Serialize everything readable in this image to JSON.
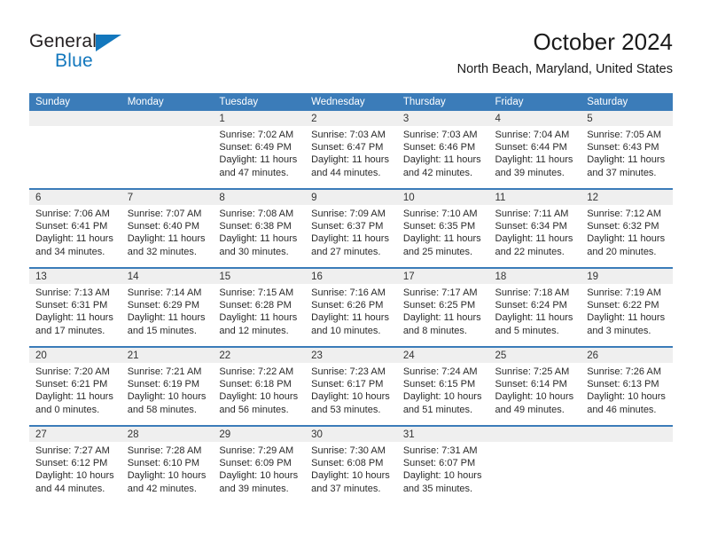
{
  "brand": {
    "name_part1": "General",
    "name_part2": "Blue",
    "triangle_color": "#1277bd"
  },
  "header": {
    "title": "October 2024",
    "subtitle": "North Beach, Maryland, United States",
    "accent_color": "#3b7cb9",
    "daynum_band_color": "#efefef"
  },
  "calendar": {
    "weekday_headers": [
      "Sunday",
      "Monday",
      "Tuesday",
      "Wednesday",
      "Thursday",
      "Friday",
      "Saturday"
    ],
    "weeks": [
      [
        {
          "day": "",
          "sunrise": "",
          "sunset": "",
          "daylight_line1": "",
          "daylight_line2": ""
        },
        {
          "day": "",
          "sunrise": "",
          "sunset": "",
          "daylight_line1": "",
          "daylight_line2": ""
        },
        {
          "day": "1",
          "sunrise": "Sunrise: 7:02 AM",
          "sunset": "Sunset: 6:49 PM",
          "daylight_line1": "Daylight: 11 hours",
          "daylight_line2": "and 47 minutes."
        },
        {
          "day": "2",
          "sunrise": "Sunrise: 7:03 AM",
          "sunset": "Sunset: 6:47 PM",
          "daylight_line1": "Daylight: 11 hours",
          "daylight_line2": "and 44 minutes."
        },
        {
          "day": "3",
          "sunrise": "Sunrise: 7:03 AM",
          "sunset": "Sunset: 6:46 PM",
          "daylight_line1": "Daylight: 11 hours",
          "daylight_line2": "and 42 minutes."
        },
        {
          "day": "4",
          "sunrise": "Sunrise: 7:04 AM",
          "sunset": "Sunset: 6:44 PM",
          "daylight_line1": "Daylight: 11 hours",
          "daylight_line2": "and 39 minutes."
        },
        {
          "day": "5",
          "sunrise": "Sunrise: 7:05 AM",
          "sunset": "Sunset: 6:43 PM",
          "daylight_line1": "Daylight: 11 hours",
          "daylight_line2": "and 37 minutes."
        }
      ],
      [
        {
          "day": "6",
          "sunrise": "Sunrise: 7:06 AM",
          "sunset": "Sunset: 6:41 PM",
          "daylight_line1": "Daylight: 11 hours",
          "daylight_line2": "and 34 minutes."
        },
        {
          "day": "7",
          "sunrise": "Sunrise: 7:07 AM",
          "sunset": "Sunset: 6:40 PM",
          "daylight_line1": "Daylight: 11 hours",
          "daylight_line2": "and 32 minutes."
        },
        {
          "day": "8",
          "sunrise": "Sunrise: 7:08 AM",
          "sunset": "Sunset: 6:38 PM",
          "daylight_line1": "Daylight: 11 hours",
          "daylight_line2": "and 30 minutes."
        },
        {
          "day": "9",
          "sunrise": "Sunrise: 7:09 AM",
          "sunset": "Sunset: 6:37 PM",
          "daylight_line1": "Daylight: 11 hours",
          "daylight_line2": "and 27 minutes."
        },
        {
          "day": "10",
          "sunrise": "Sunrise: 7:10 AM",
          "sunset": "Sunset: 6:35 PM",
          "daylight_line1": "Daylight: 11 hours",
          "daylight_line2": "and 25 minutes."
        },
        {
          "day": "11",
          "sunrise": "Sunrise: 7:11 AM",
          "sunset": "Sunset: 6:34 PM",
          "daylight_line1": "Daylight: 11 hours",
          "daylight_line2": "and 22 minutes."
        },
        {
          "day": "12",
          "sunrise": "Sunrise: 7:12 AM",
          "sunset": "Sunset: 6:32 PM",
          "daylight_line1": "Daylight: 11 hours",
          "daylight_line2": "and 20 minutes."
        }
      ],
      [
        {
          "day": "13",
          "sunrise": "Sunrise: 7:13 AM",
          "sunset": "Sunset: 6:31 PM",
          "daylight_line1": "Daylight: 11 hours",
          "daylight_line2": "and 17 minutes."
        },
        {
          "day": "14",
          "sunrise": "Sunrise: 7:14 AM",
          "sunset": "Sunset: 6:29 PM",
          "daylight_line1": "Daylight: 11 hours",
          "daylight_line2": "and 15 minutes."
        },
        {
          "day": "15",
          "sunrise": "Sunrise: 7:15 AM",
          "sunset": "Sunset: 6:28 PM",
          "daylight_line1": "Daylight: 11 hours",
          "daylight_line2": "and 12 minutes."
        },
        {
          "day": "16",
          "sunrise": "Sunrise: 7:16 AM",
          "sunset": "Sunset: 6:26 PM",
          "daylight_line1": "Daylight: 11 hours",
          "daylight_line2": "and 10 minutes."
        },
        {
          "day": "17",
          "sunrise": "Sunrise: 7:17 AM",
          "sunset": "Sunset: 6:25 PM",
          "daylight_line1": "Daylight: 11 hours",
          "daylight_line2": "and 8 minutes."
        },
        {
          "day": "18",
          "sunrise": "Sunrise: 7:18 AM",
          "sunset": "Sunset: 6:24 PM",
          "daylight_line1": "Daylight: 11 hours",
          "daylight_line2": "and 5 minutes."
        },
        {
          "day": "19",
          "sunrise": "Sunrise: 7:19 AM",
          "sunset": "Sunset: 6:22 PM",
          "daylight_line1": "Daylight: 11 hours",
          "daylight_line2": "and 3 minutes."
        }
      ],
      [
        {
          "day": "20",
          "sunrise": "Sunrise: 7:20 AM",
          "sunset": "Sunset: 6:21 PM",
          "daylight_line1": "Daylight: 11 hours",
          "daylight_line2": "and 0 minutes."
        },
        {
          "day": "21",
          "sunrise": "Sunrise: 7:21 AM",
          "sunset": "Sunset: 6:19 PM",
          "daylight_line1": "Daylight: 10 hours",
          "daylight_line2": "and 58 minutes."
        },
        {
          "day": "22",
          "sunrise": "Sunrise: 7:22 AM",
          "sunset": "Sunset: 6:18 PM",
          "daylight_line1": "Daylight: 10 hours",
          "daylight_line2": "and 56 minutes."
        },
        {
          "day": "23",
          "sunrise": "Sunrise: 7:23 AM",
          "sunset": "Sunset: 6:17 PM",
          "daylight_line1": "Daylight: 10 hours",
          "daylight_line2": "and 53 minutes."
        },
        {
          "day": "24",
          "sunrise": "Sunrise: 7:24 AM",
          "sunset": "Sunset: 6:15 PM",
          "daylight_line1": "Daylight: 10 hours",
          "daylight_line2": "and 51 minutes."
        },
        {
          "day": "25",
          "sunrise": "Sunrise: 7:25 AM",
          "sunset": "Sunset: 6:14 PM",
          "daylight_line1": "Daylight: 10 hours",
          "daylight_line2": "and 49 minutes."
        },
        {
          "day": "26",
          "sunrise": "Sunrise: 7:26 AM",
          "sunset": "Sunset: 6:13 PM",
          "daylight_line1": "Daylight: 10 hours",
          "daylight_line2": "and 46 minutes."
        }
      ],
      [
        {
          "day": "27",
          "sunrise": "Sunrise: 7:27 AM",
          "sunset": "Sunset: 6:12 PM",
          "daylight_line1": "Daylight: 10 hours",
          "daylight_line2": "and 44 minutes."
        },
        {
          "day": "28",
          "sunrise": "Sunrise: 7:28 AM",
          "sunset": "Sunset: 6:10 PM",
          "daylight_line1": "Daylight: 10 hours",
          "daylight_line2": "and 42 minutes."
        },
        {
          "day": "29",
          "sunrise": "Sunrise: 7:29 AM",
          "sunset": "Sunset: 6:09 PM",
          "daylight_line1": "Daylight: 10 hours",
          "daylight_line2": "and 39 minutes."
        },
        {
          "day": "30",
          "sunrise": "Sunrise: 7:30 AM",
          "sunset": "Sunset: 6:08 PM",
          "daylight_line1": "Daylight: 10 hours",
          "daylight_line2": "and 37 minutes."
        },
        {
          "day": "31",
          "sunrise": "Sunrise: 7:31 AM",
          "sunset": "Sunset: 6:07 PM",
          "daylight_line1": "Daylight: 10 hours",
          "daylight_line2": "and 35 minutes."
        },
        {
          "day": "",
          "sunrise": "",
          "sunset": "",
          "daylight_line1": "",
          "daylight_line2": ""
        },
        {
          "day": "",
          "sunrise": "",
          "sunset": "",
          "daylight_line1": "",
          "daylight_line2": ""
        }
      ]
    ]
  }
}
